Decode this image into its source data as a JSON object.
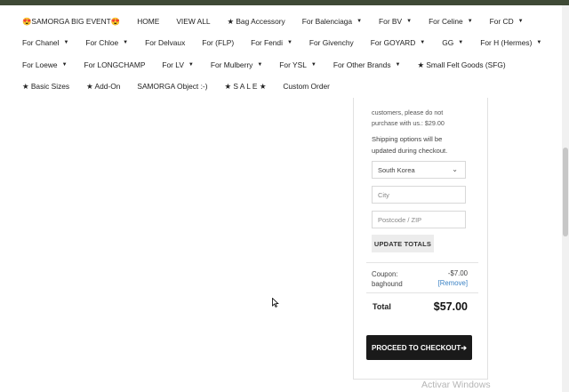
{
  "nav": {
    "rows": [
      [
        {
          "label": "😍SAMORGA BIG EVENT😍",
          "caret": false
        },
        {
          "label": "HOME",
          "caret": false
        },
        {
          "label": "VIEW ALL",
          "caret": false
        },
        {
          "label": "★ Bag Accessory",
          "caret": false
        },
        {
          "label": "For Balenciaga",
          "caret": true
        },
        {
          "label": "For BV",
          "caret": true
        },
        {
          "label": "For Celine",
          "caret": true
        },
        {
          "label": "For CD",
          "caret": true
        }
      ],
      [
        {
          "label": "For Chanel",
          "caret": true
        },
        {
          "label": "For Chloe",
          "caret": true
        },
        {
          "label": "For Delvaux",
          "caret": false
        },
        {
          "label": "For (FLP)",
          "caret": false
        },
        {
          "label": "For Fendi",
          "caret": true
        },
        {
          "label": "For Givenchy",
          "caret": false
        },
        {
          "label": "For GOYARD",
          "caret": true
        },
        {
          "label": "GG",
          "caret": true
        },
        {
          "label": "For H (Hermes)",
          "caret": true
        }
      ],
      [
        {
          "label": "For Loewe",
          "caret": true
        },
        {
          "label": "For LONGCHAMP",
          "caret": false
        },
        {
          "label": "For LV",
          "caret": true
        },
        {
          "label": "For Mulberry",
          "caret": true
        },
        {
          "label": "For YSL",
          "caret": true
        },
        {
          "label": "For Other Brands",
          "caret": true
        },
        {
          "label": "★ Small Felt Goods (SFG)",
          "caret": false
        }
      ],
      [
        {
          "label": "★ Basic Sizes",
          "caret": false
        },
        {
          "label": "★ Add-On",
          "caret": false
        },
        {
          "label": "SAMORGA Object :-)",
          "caret": false
        },
        {
          "label": "★ S A L E ★",
          "caret": false
        },
        {
          "label": "Custom Order",
          "caret": false
        }
      ]
    ]
  },
  "cart": {
    "note_line1": "customers, please do not",
    "note_line2": "purchase with us.: $29.00",
    "shipping_line1": "Shipping options will be",
    "shipping_line2": "updated during checkout.",
    "country_value": "South Korea",
    "city_placeholder": "City",
    "postcode_placeholder": "Postcode / ZIP",
    "update_button": "UPDATE TOTALS",
    "coupon_label_line1": "Coupon:",
    "coupon_label_line2": "baghound",
    "coupon_amount": "-$7.00",
    "remove_link": "[Remove]",
    "total_label": "Total",
    "total_amount": "$57.00",
    "checkout_button": "PROCEED TO CHECKOUT",
    "checkout_arrow": "➔"
  },
  "os": {
    "watermark": "Activar Windows"
  },
  "colors": {
    "topbar": "#3f4a36",
    "checkout_bg": "#1a1a1a",
    "link": "#3b82c4"
  }
}
